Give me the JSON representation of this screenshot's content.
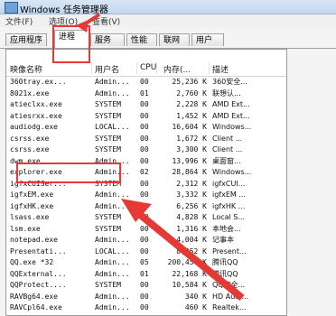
{
  "window": {
    "title": "Windows 任务管理器"
  },
  "menu": [
    "文件(F)",
    "选项(O)",
    "查看(V)"
  ],
  "tabs": [
    {
      "label": "应用程序",
      "active": false
    },
    {
      "label": "进程",
      "active": true
    },
    {
      "label": "服务",
      "active": false
    },
    {
      "label": "性能",
      "active": false
    },
    {
      "label": "联网",
      "active": false
    },
    {
      "label": "用户",
      "active": false
    }
  ],
  "columns": {
    "image": "映像名称",
    "user": "用户名",
    "cpu": "CPU",
    "mem": "内存(...",
    "desc": "描述"
  },
  "rows": [
    {
      "image": "360tray.ex...",
      "user": "Admin...",
      "cpu": "00",
      "mem": "25,236 K",
      "desc": "360安全..."
    },
    {
      "image": "8021x.exe",
      "user": "Admin...",
      "cpu": "01",
      "mem": "2,760 K",
      "desc": "联想认..."
    },
    {
      "image": "atieclxx.exe",
      "user": "SYSTEM",
      "cpu": "00",
      "mem": "2,228 K",
      "desc": "AMD Ext..."
    },
    {
      "image": "atiesrxx.exe",
      "user": "SYSTEM",
      "cpu": "00",
      "mem": "1,452 K",
      "desc": "AMD Ext..."
    },
    {
      "image": "audiodg.exe",
      "user": "LOCAL...",
      "cpu": "00",
      "mem": "16,604 K",
      "desc": "Windows..."
    },
    {
      "image": "csrss.exe",
      "user": "SYSTEM",
      "cpu": "00",
      "mem": "1,672 K",
      "desc": "Client ..."
    },
    {
      "image": "csrss.exe",
      "user": "SYSTEM",
      "cpu": "00",
      "mem": "3,300 K",
      "desc": "Client ..."
    },
    {
      "image": "dwm.exe",
      "user": "Admin...",
      "cpu": "00",
      "mem": "13,996 K",
      "desc": "桌面窗..."
    },
    {
      "image": "explorer.exe",
      "user": "Admin...",
      "cpu": "02",
      "mem": "28,864 K",
      "desc": "Windows..."
    },
    {
      "image": "igfxCUISer...",
      "user": "SYSTEM",
      "cpu": "00",
      "mem": "2,312 K",
      "desc": "igfxCUI..."
    },
    {
      "image": "igfxEM.exe",
      "user": "Admin...",
      "cpu": "00",
      "mem": "3,332 K",
      "desc": "igfxEM ..."
    },
    {
      "image": "igfxHK.exe",
      "user": "Admin...",
      "cpu": "00",
      "mem": "6,256 K",
      "desc": "igfxHK ..."
    },
    {
      "image": "lsass.exe",
      "user": "SYSTEM",
      "cpu": "00",
      "mem": "4,828 K",
      "desc": "Local S..."
    },
    {
      "image": "lsm.exe",
      "user": "SYSTEM",
      "cpu": "00",
      "mem": "1,316 K",
      "desc": "本地会..."
    },
    {
      "image": "notepad.exe",
      "user": "Admin...",
      "cpu": "00",
      "mem": "4,004 K",
      "desc": "记事本"
    },
    {
      "image": "Presentati...",
      "user": "LOCAL...",
      "cpu": "00",
      "mem": "8,252 K",
      "desc": "Present..."
    },
    {
      "image": "QQ.exe *32",
      "user": "Admin...",
      "cpu": "05",
      "mem": "200,456 K",
      "desc": "腾讯QQ"
    },
    {
      "image": "QQExternal...",
      "user": "Admin...",
      "cpu": "01",
      "mem": "22,168 K",
      "desc": "腾讯QQ"
    },
    {
      "image": "QQProtect....",
      "user": "SYSTEM",
      "cpu": "00",
      "mem": "10,584 K",
      "desc": "QQ安全..."
    },
    {
      "image": "RAVBg64.exe",
      "user": "Admin...",
      "cpu": "00",
      "mem": "340 K",
      "desc": "HD Audi..."
    },
    {
      "image": "RAVCpl64.exe",
      "user": "Admin...",
      "cpu": "00",
      "mem": "460 K",
      "desc": "Realtek..."
    },
    {
      "image": "rundll32.exe",
      "user": "Admin...",
      "cpu": "00",
      "mem": "1,740 K",
      "desc": "Windows..."
    }
  ],
  "colors": {
    "annotation": "#e53935"
  }
}
